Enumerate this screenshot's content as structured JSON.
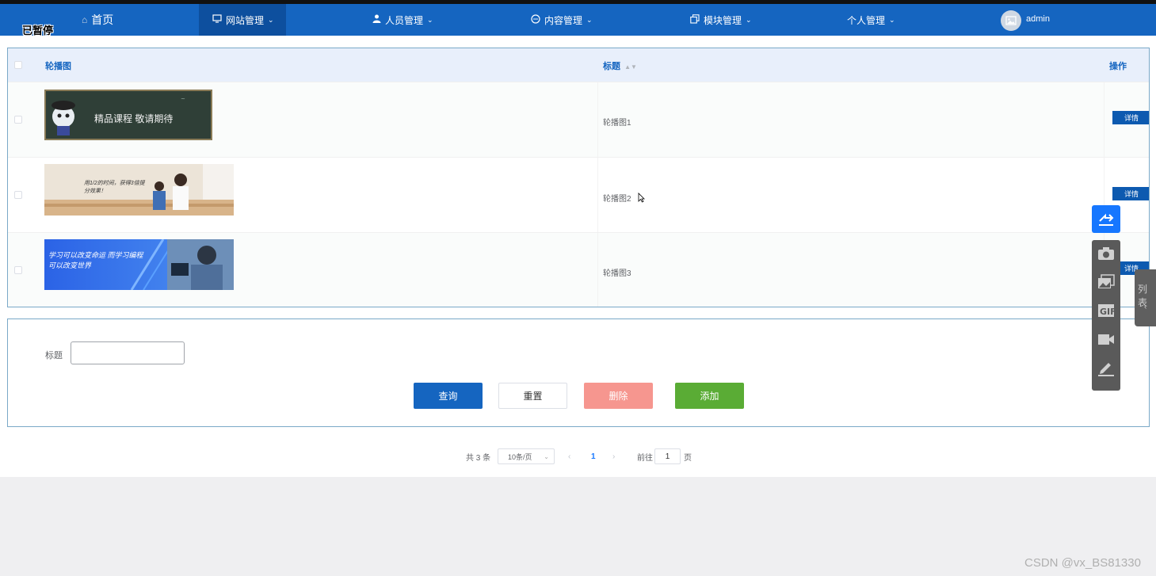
{
  "overlay": {
    "paused": "已暂停"
  },
  "nav": {
    "home": "首页",
    "site": "网站管理",
    "people": "人员管理",
    "content": "内容管理",
    "module": "模块管理",
    "personal": "个人管理",
    "user": "admin"
  },
  "table": {
    "headers": {
      "banner": "轮播图",
      "title": "标题",
      "action": "操作"
    },
    "rows": [
      {
        "title": "轮播图1",
        "action": "详情",
        "banner_text": "精品课程 敬请期待"
      },
      {
        "title": "轮播图2",
        "action": "详情",
        "banner_text": "用1/2的时间，获得3倍提分效果！"
      },
      {
        "title": "轮播图3",
        "action": "详情",
        "banner_text": "学习可以改变命运 而学习编程可以改变世界"
      }
    ]
  },
  "search": {
    "label": "标题",
    "value": "",
    "query": "查询",
    "reset": "重置",
    "delete": "删除",
    "add": "添加"
  },
  "pager": {
    "total": "共 3 条",
    "size": "10条/页",
    "current": "1",
    "goto_label": "前往",
    "goto_value": "1",
    "page_suffix": "页"
  },
  "side_tab": "列表",
  "watermark": "CSDN @vx_BS81330",
  "colors": {
    "nav": "#1565c0",
    "nav_active": "#0d4f9e",
    "delete": "#f6968f",
    "add": "#5aac35"
  }
}
